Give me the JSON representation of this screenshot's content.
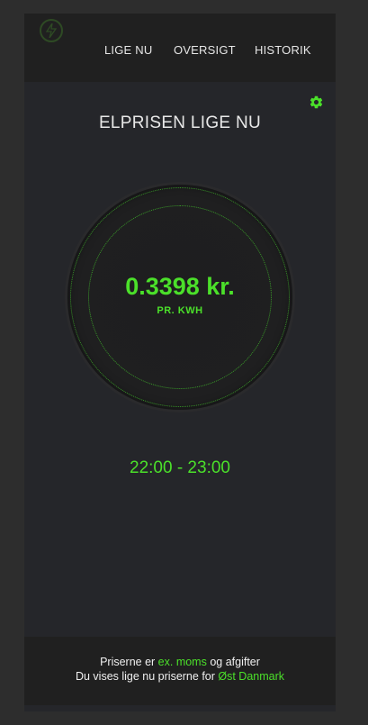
{
  "nav": {
    "items": [
      "LIGE NU",
      "OVERSIGT",
      "HISTORIK"
    ]
  },
  "header": {
    "title": "ELPRISEN LIGE NU"
  },
  "gauge": {
    "price": "0.3398 kr.",
    "unit": "PR. KWH"
  },
  "time_range": "22:00 - 23:00",
  "footer": {
    "line1_prefix": "Priserne er ",
    "line1_highlight": "ex. moms",
    "line1_suffix": " og afgifter",
    "line2_prefix": "Du vises lige nu priserne for ",
    "line2_highlight": "Øst Danmark"
  },
  "colors": {
    "accent": "#4be02a",
    "background": "#25262a",
    "bar": "#202020"
  },
  "icons": {
    "logo": "lightning-bolt-icon",
    "settings": "gear-icon"
  }
}
